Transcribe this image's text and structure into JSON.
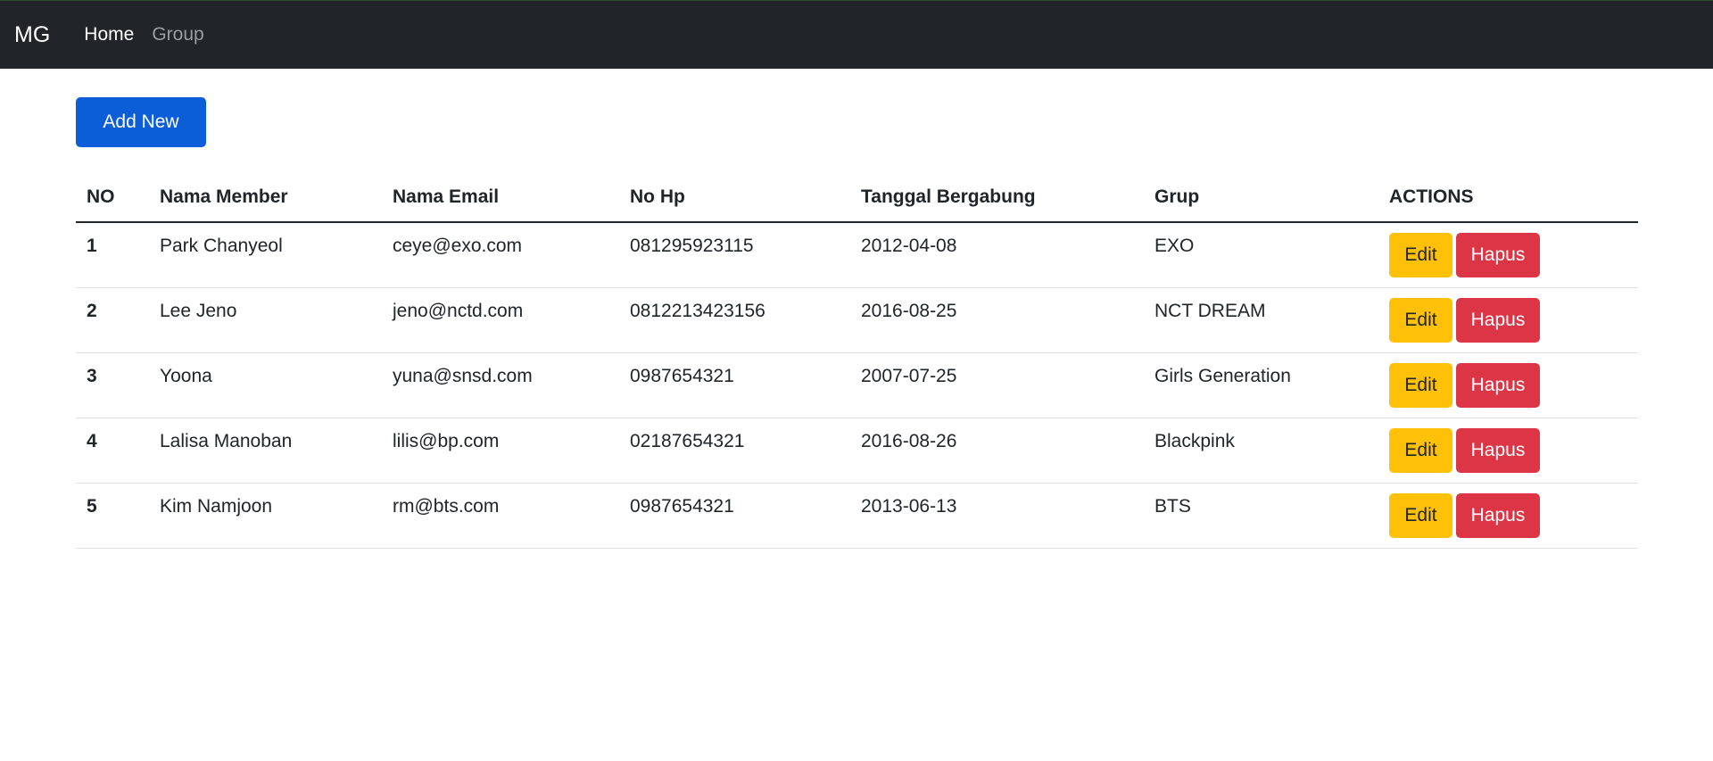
{
  "navbar": {
    "brand": "MG",
    "links": [
      {
        "label": "Home",
        "active": true
      },
      {
        "label": "Group",
        "active": false
      }
    ]
  },
  "toolbar": {
    "add_label": "Add New"
  },
  "table": {
    "headers": [
      "NO",
      "Nama Member",
      "Nama Email",
      "No Hp",
      "Tanggal Bergabung",
      "Grup",
      "ACTIONS"
    ],
    "edit_label": "Edit",
    "delete_label": "Hapus",
    "rows": [
      {
        "no": "1",
        "name": "Park Chanyeol",
        "email": "ceye@exo.com",
        "hp": "081295923115",
        "date": "2012-04-08",
        "group": "EXO"
      },
      {
        "no": "2",
        "name": "Lee Jeno",
        "email": "jeno@nctd.com",
        "hp": "0812213423156",
        "date": "2016-08-25",
        "group": "NCT DREAM"
      },
      {
        "no": "3",
        "name": "Yoona",
        "email": "yuna@snsd.com",
        "hp": "0987654321",
        "date": "2007-07-25",
        "group": "Girls Generation"
      },
      {
        "no": "4",
        "name": "Lalisa Manoban",
        "email": "lilis@bp.com",
        "hp": "02187654321",
        "date": "2016-08-26",
        "group": "Blackpink"
      },
      {
        "no": "5",
        "name": "Kim Namjoon",
        "email": "rm@bts.com",
        "hp": "0987654321",
        "date": "2013-06-13",
        "group": "BTS"
      }
    ]
  },
  "colors": {
    "navbar_bg": "#212529",
    "primary": "#0b5ed7",
    "warning": "#ffc107",
    "danger": "#dc3545"
  }
}
